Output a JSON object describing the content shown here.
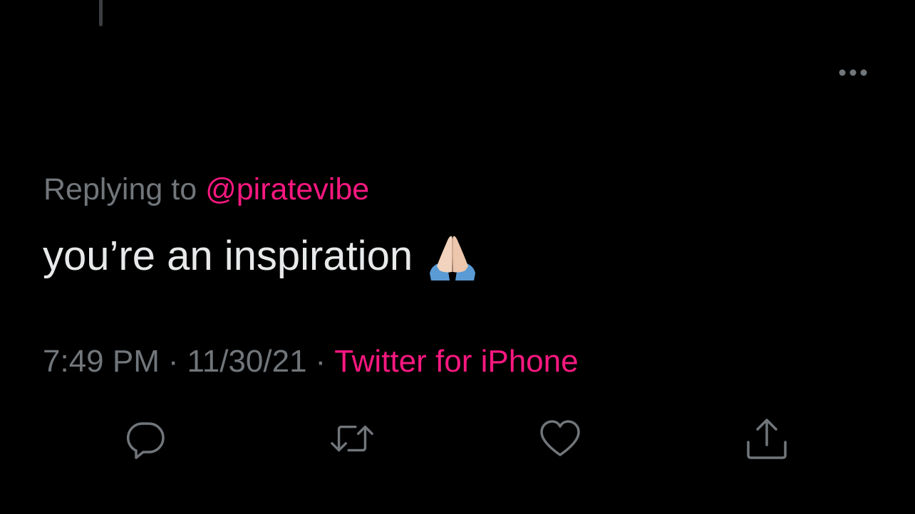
{
  "thread": {
    "connector_color": "#3a3d40"
  },
  "header": {
    "more_icon": "more-horizontal-icon"
  },
  "reply": {
    "prefix": "Replying to",
    "handle": "@piratevibe"
  },
  "tweet": {
    "text": "you’re an inspiration",
    "emoji": "🙏🏻"
  },
  "meta": {
    "time": "7:49 PM",
    "separator": "·",
    "date": "11/30/21",
    "source": "Twitter for iPhone"
  },
  "actions": {
    "reply_icon": "reply-bubble-icon",
    "retweet_icon": "retweet-icon",
    "like_icon": "heart-icon",
    "share_icon": "share-upload-icon"
  },
  "colors": {
    "background": "#000000",
    "text_primary": "#e7e9ea",
    "text_secondary": "#71767b",
    "accent": "#f91880"
  }
}
